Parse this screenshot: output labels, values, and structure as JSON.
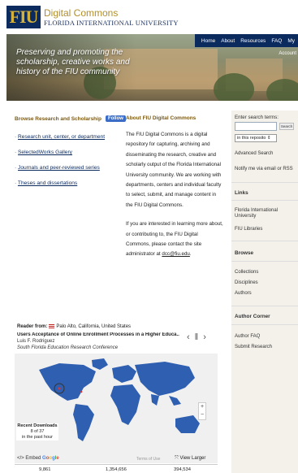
{
  "header": {
    "logo": "FIU",
    "brand_line1": "Digital Commons",
    "brand_line2": "FLORIDA INTERNATIONAL UNIVERSITY"
  },
  "banner": {
    "tagline": "Preserving and promoting the scholarship, creative works and history of the FIU community",
    "nav": [
      "Home",
      "About",
      "Resources",
      "FAQ",
      "My"
    ],
    "account": "Account"
  },
  "browse": {
    "heading": "Browse Research and Scholarship",
    "follow_label": "Follow",
    "links": [
      "Research unit, center, or department",
      "SelectedWorks Gallery",
      "Journals and peer-reviewed series",
      "Theses and dissertations"
    ]
  },
  "about": {
    "heading": "About FIU Digital Commons",
    "para1": "The FIU Digital Commons is a digital repository for capturing, archiving and disseminating the research, creative and scholarly output of the Florida International University community. We are working with departments, centers and individual faculty to select, submit, and manage content in the FIU Digital Commons.",
    "para2_prefix": "If you are interested in learning more about, or contributing to, the FIU Digital Commons, please contact the site administrator at ",
    "email": "dcc@fiu.edu",
    "para2_suffix": "."
  },
  "sidebar": {
    "search_label": "Enter search terms:",
    "search_value": "",
    "search_button": "Search",
    "scope_selected": "in this reposito",
    "advanced_search": "Advanced Search",
    "notify": "Notify me via email or RSS",
    "links_heading": "Links",
    "links": [
      "Florida International University",
      "FIU Libraries"
    ],
    "browse_heading": "Browse",
    "browse_links": [
      "Collections",
      "Disciplines",
      "Authors"
    ],
    "author_heading": "Author Corner",
    "author_links": [
      "Author FAQ",
      "Submit Research"
    ]
  },
  "readership": {
    "reader_prefix": "Reader from:",
    "reader_location": "Palo Alto, California, United States",
    "title": "Users Acceptance of Online Enrollment Processes in a Higher Educa...",
    "author": "Luis F. Rodriguez",
    "conference": "South Florida Education Research Conference",
    "recent_heading": "Recent Downloads",
    "recent_count": "8 of 37",
    "recent_period": "in the past hour",
    "embed_label": "Embed",
    "google": "Google",
    "terms": "Terms of Use",
    "view_larger": "View Larger",
    "stats": [
      "9,861",
      "1,354,656",
      "394,534"
    ]
  },
  "colors": {
    "navy": "#0b2a5e",
    "gold": "#b08f2a",
    "map_land": "#2f5fb0",
    "map_bg": "#f0f0f0"
  }
}
